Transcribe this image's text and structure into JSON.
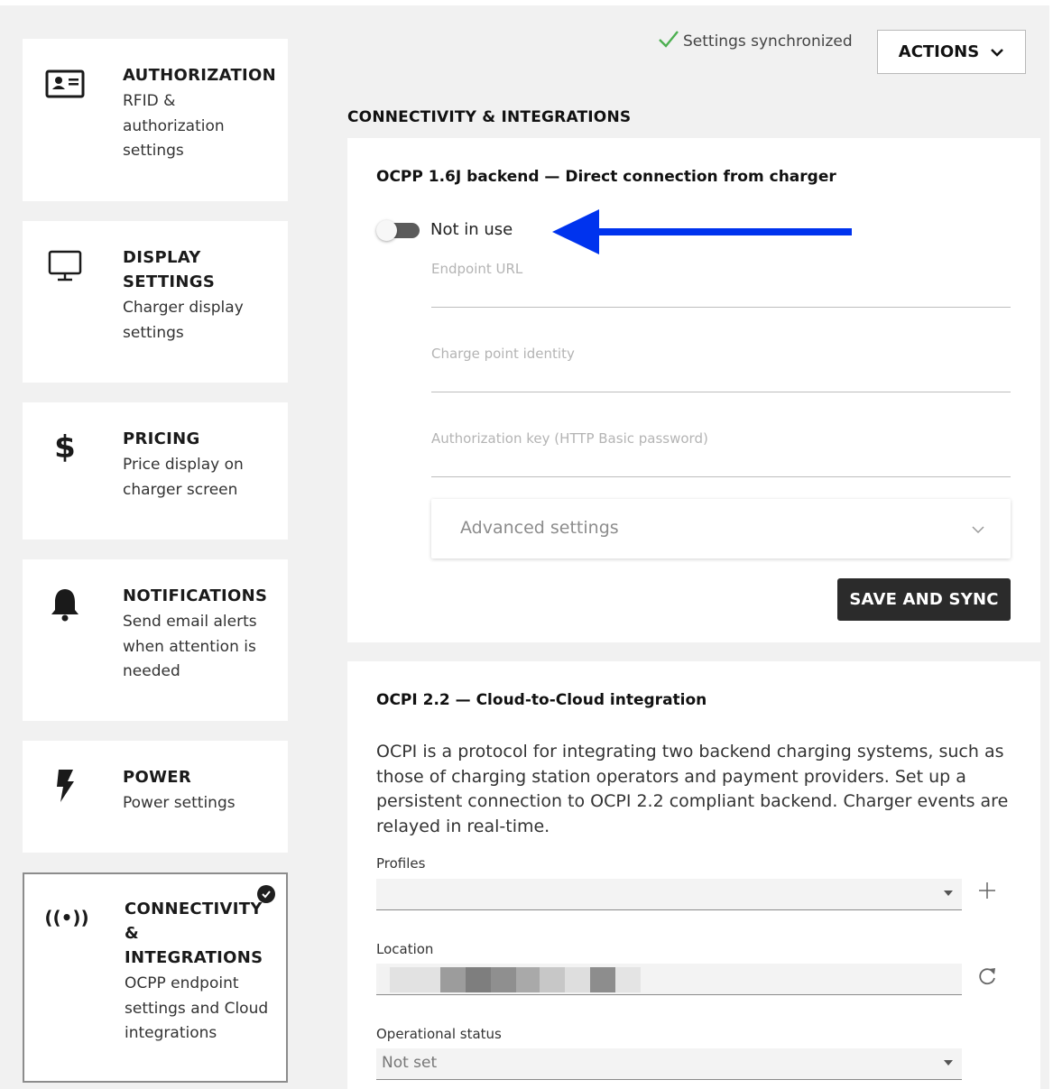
{
  "sidebar": {
    "items": [
      {
        "id": "authorization",
        "title": "AUTHORIZATION",
        "desc": "RFID & authorization settings",
        "icon": "id-card-icon"
      },
      {
        "id": "display",
        "title": "DISPLAY SETTINGS",
        "desc": "Charger display settings",
        "icon": "monitor-icon"
      },
      {
        "id": "pricing",
        "title": "PRICING",
        "desc": "Price display on charger screen",
        "icon": "dollar-icon"
      },
      {
        "id": "notifications",
        "title": "NOTIFICATIONS",
        "desc": "Send email alerts when attention is needed",
        "icon": "bell-icon"
      },
      {
        "id": "power",
        "title": "POWER",
        "desc": "Power settings",
        "icon": "lightning-icon"
      },
      {
        "id": "connectivity",
        "title": "CONNECTIVITY & INTEGRATIONS",
        "desc": "OCPP endpoint settings and Cloud integrations",
        "icon": "broadcast-icon",
        "active": true
      }
    ]
  },
  "header": {
    "sync_status": "Settings synchronized",
    "actions_label": "ACTIONS",
    "section_title": "CONNECTIVITY & INTEGRATIONS"
  },
  "ocpp": {
    "title": "OCPP 1.6J backend — Direct connection from charger",
    "toggle_label": "Not in use",
    "toggle_on": false,
    "fields": {
      "endpoint_url": {
        "label": "Endpoint URL",
        "value": ""
      },
      "charge_point_identity": {
        "label": "Charge point identity",
        "value": ""
      },
      "authorization_key": {
        "label": "Authorization key (HTTP Basic password)",
        "value": ""
      }
    },
    "advanced_label": "Advanced settings",
    "save_label": "SAVE AND SYNC"
  },
  "ocpi": {
    "title": "OCPI 2.2 — Cloud-to-Cloud integration",
    "description": "OCPI is a protocol for integrating two backend charging systems, such as those of charging station operators and payment providers. Set up a persistent connection to OCPI 2.2 compliant backend. Charger events are relayed in real-time.",
    "profiles_label": "Profiles",
    "profiles_value": "",
    "location_label": "Location",
    "operational_status_label": "Operational status",
    "operational_status_value": "Not set"
  },
  "colors": {
    "arrow": "#0033ee",
    "sync_check": "#4caf50",
    "save_button": "#2b2b2b"
  }
}
